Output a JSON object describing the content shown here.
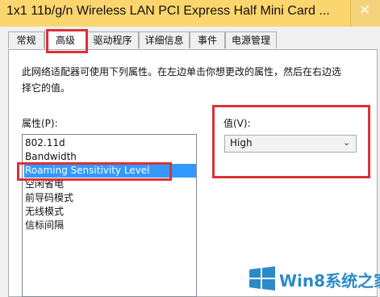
{
  "window": {
    "title": "1x1 11b/g/n Wireless LAN PCI Express Half Mini Card ...",
    "close_glyph": "✕"
  },
  "tabs": [
    {
      "label": "常规"
    },
    {
      "label": "高级"
    },
    {
      "label": "驱动程序"
    },
    {
      "label": "详细信息"
    },
    {
      "label": "事件"
    },
    {
      "label": "电源管理"
    }
  ],
  "advanced": {
    "description": "此网络适配器可使用下列属性。在左边单击你想更改的属性，然后在右边选择它的值。",
    "property_label": "属性(P):",
    "properties": [
      "802.11d",
      "Bandwidth",
      "Roaming Sensitivity Level",
      "空闲省电",
      "前导码模式",
      "无线模式",
      "信标间隔"
    ],
    "selected_property": "Roaming Sensitivity Level",
    "value_label": "值(V):",
    "value_selected": "High",
    "value_chevron": "⌄"
  },
  "watermark": {
    "text": "Win8系统之家"
  },
  "colors": {
    "title_bar": "#fbd56d",
    "highlight_box": "#dc3138",
    "selection": "#3399ff",
    "watermark": "#2c8ac9"
  }
}
